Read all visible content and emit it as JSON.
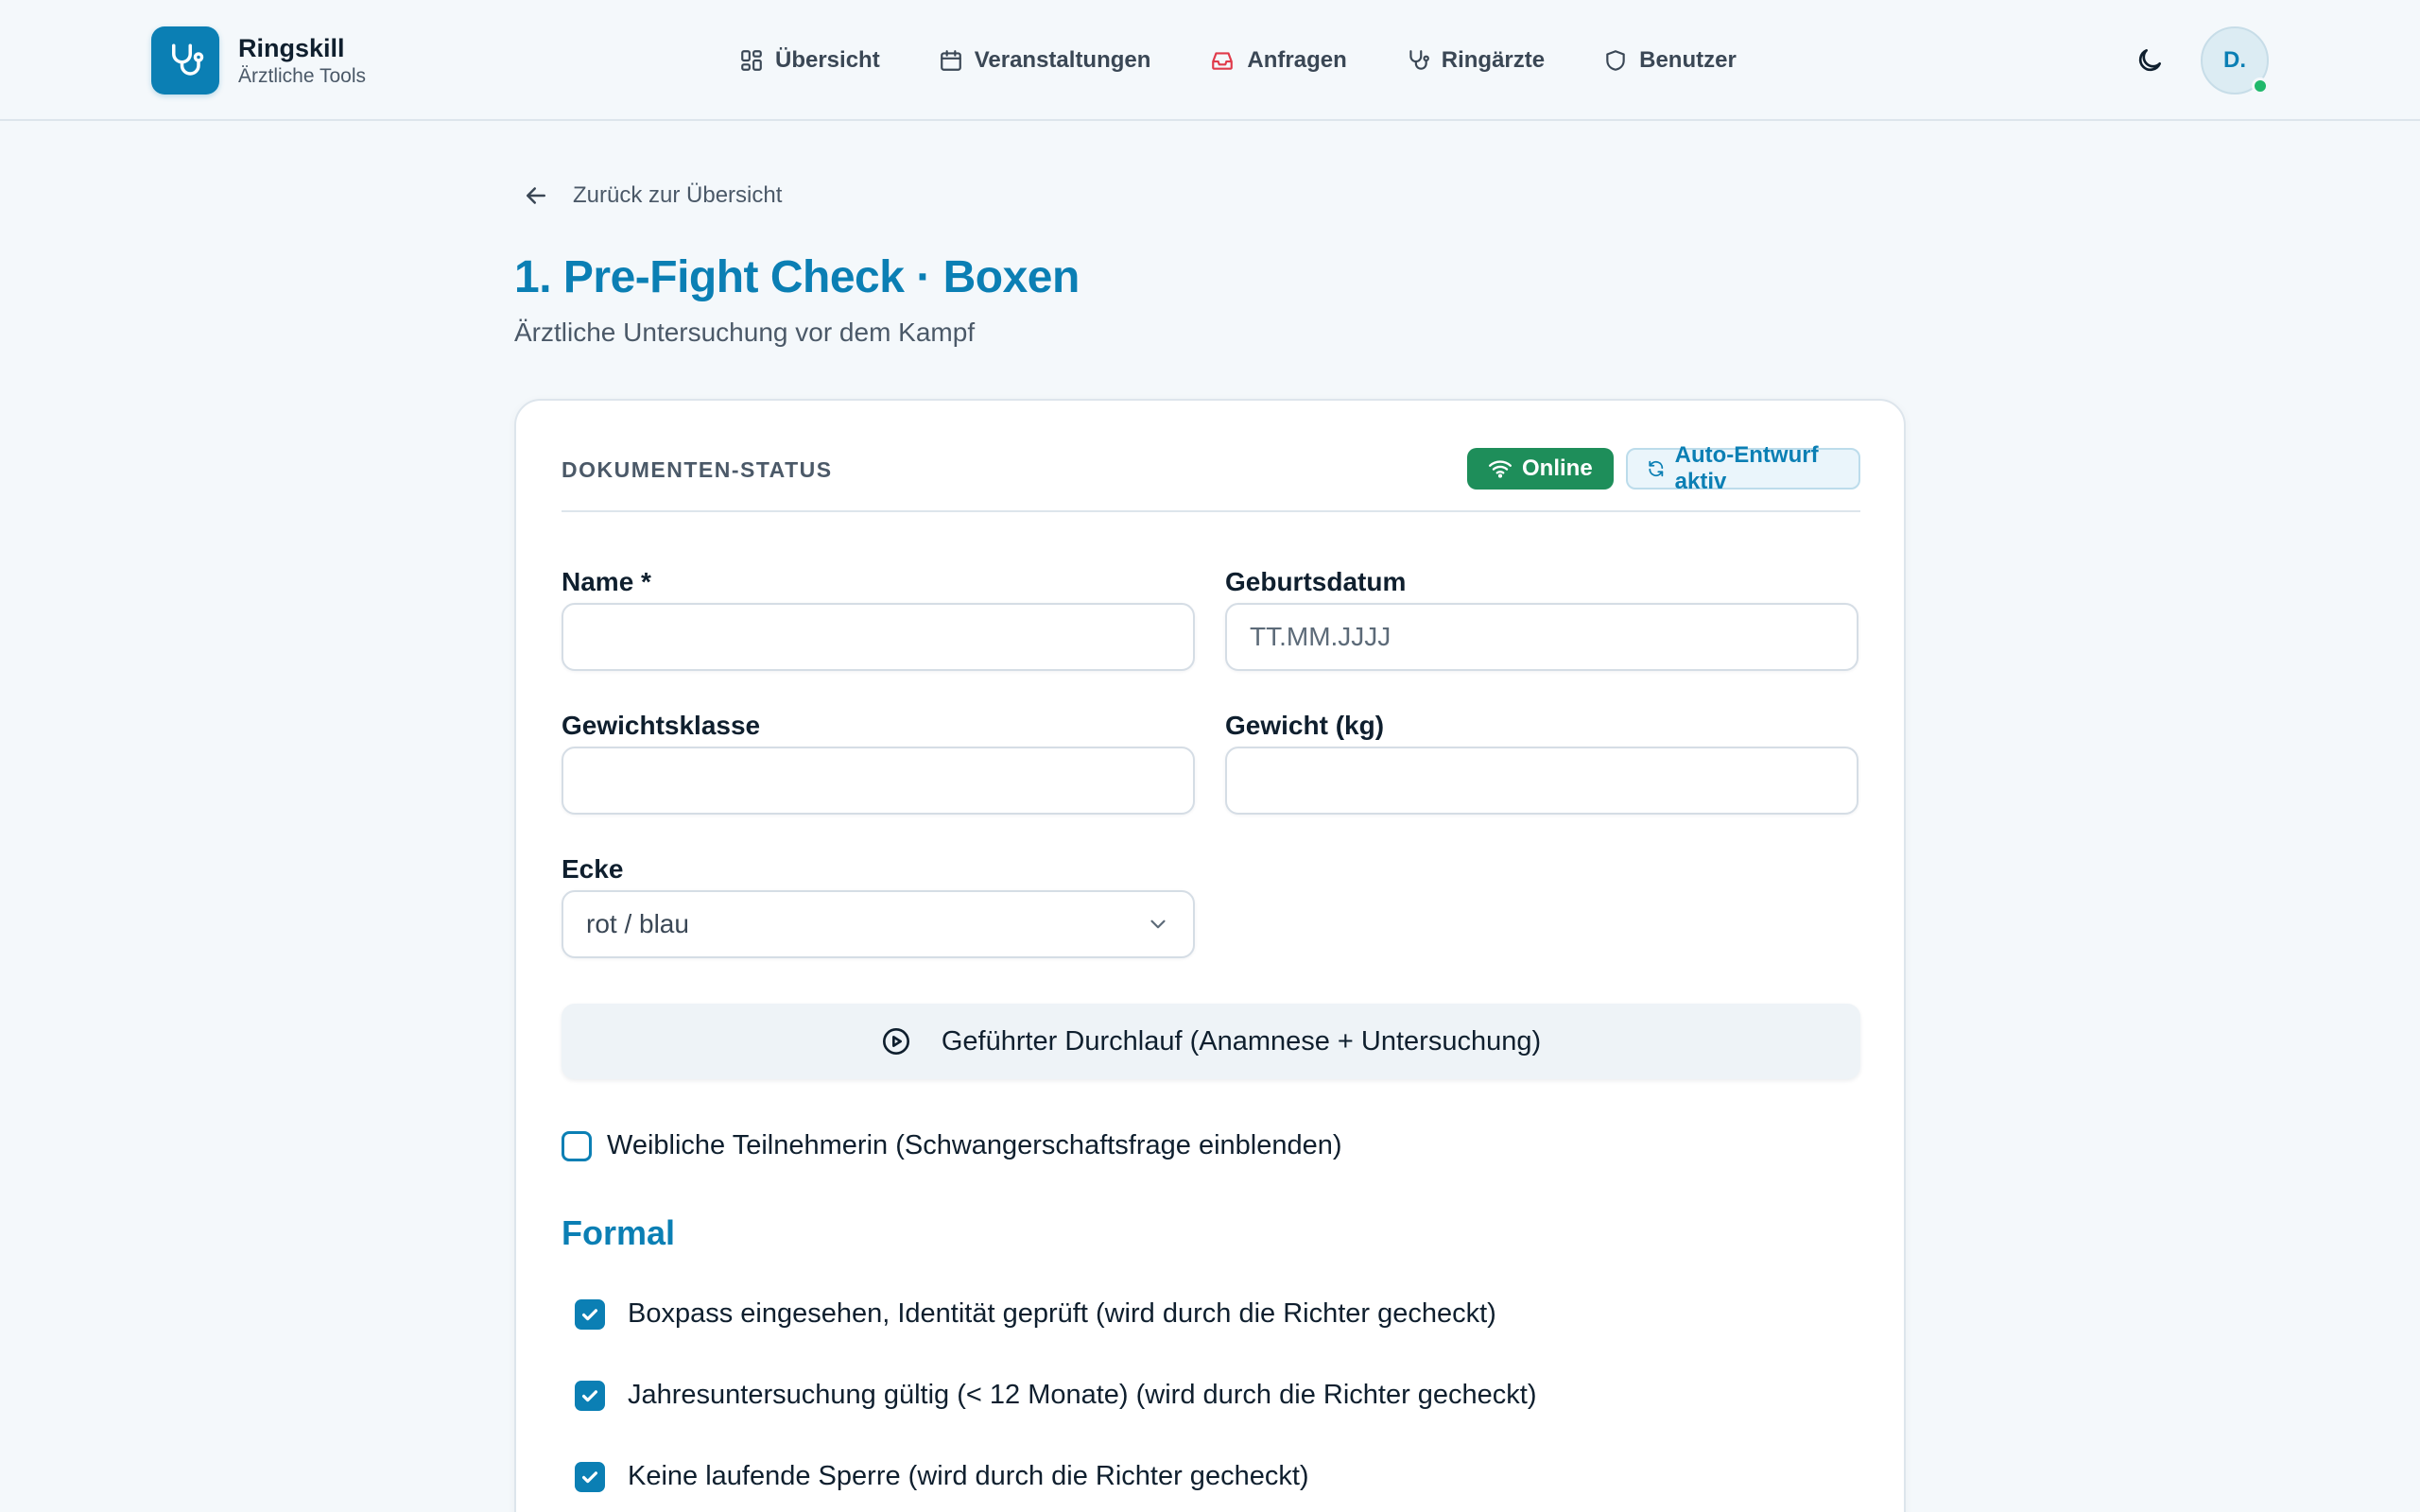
{
  "app": {
    "name": "Ringskill",
    "subtitle": "Ärztliche Tools"
  },
  "nav": {
    "items": [
      {
        "label": "Übersicht",
        "icon": "grid-icon"
      },
      {
        "label": "Veranstaltungen",
        "icon": "calendar-icon"
      },
      {
        "label": "Anfragen",
        "icon": "inbox-icon"
      },
      {
        "label": "Ringärzte",
        "icon": "stethoscope-icon"
      },
      {
        "label": "Benutzer",
        "icon": "shield-icon"
      }
    ],
    "active_color": "#e03a4a"
  },
  "user": {
    "initials": "D.",
    "online": true
  },
  "page": {
    "back_label": "Zurück zur Übersicht",
    "title": "1. Pre-Fight Check · Boxen",
    "subtitle": "Ärztliche Untersuchung vor dem Kampf"
  },
  "status": {
    "label": "DOKUMENTEN-STATUS",
    "online_label": "Online",
    "draft_label": "Auto-Entwurf aktiv"
  },
  "form": {
    "name_label": "Name *",
    "name_value": "",
    "birthdate_label": "Geburtsdatum",
    "birthdate_placeholder": "TT.MM.JJJJ",
    "weightclass_label": "Gewichtsklasse",
    "weightclass_value": "",
    "weight_label": "Gewicht (kg)",
    "weight_value": "",
    "corner_label": "Ecke",
    "corner_value": "rot / blau",
    "guided_button": "Geführter Durchlauf (Anamnese + Untersuchung)",
    "female_label": "Weibliche Teilnehmerin (Schwangerschaftsfrage einblenden)",
    "female_checked": false
  },
  "formal": {
    "title": "Formal",
    "items": [
      {
        "label": "Boxpass eingesehen, Identität geprüft (wird durch die Richter gecheckt)",
        "checked": true
      },
      {
        "label": "Jahresuntersuchung gültig (< 12 Monate) (wird durch die Richter gecheckt)",
        "checked": true
      },
      {
        "label": "Keine laufende Sperre (wird durch die Richter gecheckt)",
        "checked": true
      }
    ]
  },
  "colors": {
    "brand": "#0b7fb4",
    "online": "#1e8e5a",
    "background": "#f4f8fb"
  }
}
